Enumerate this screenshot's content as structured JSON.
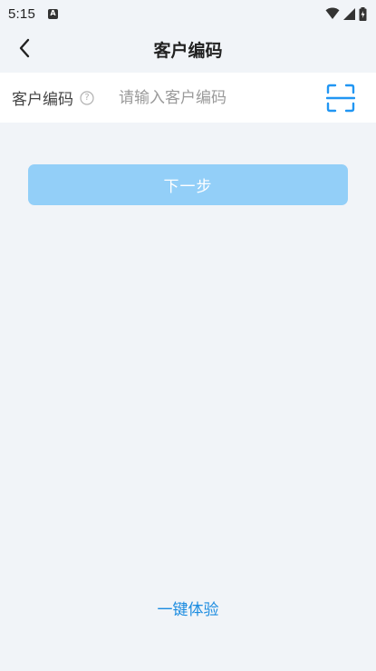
{
  "status_bar": {
    "time": "5:15",
    "notification_icon_glyph": "A",
    "icons": [
      "wifi-icon",
      "cellular-signal-icon",
      "battery-icon"
    ]
  },
  "header": {
    "title": "客户编码",
    "back_icon": "chevron-left-icon"
  },
  "form": {
    "label": "客户编码",
    "help_icon_glyph": "?",
    "input_value": "",
    "input_placeholder": "请输入客户编码",
    "scan_icon": "scan-icon"
  },
  "actions": {
    "next_label": "下一步",
    "try_link_label": "一键体验"
  },
  "colors": {
    "background": "#f1f4f8",
    "accent": "#1a8be0",
    "button_disabled": "#93cff8",
    "scan_icon": "#2196f3"
  }
}
